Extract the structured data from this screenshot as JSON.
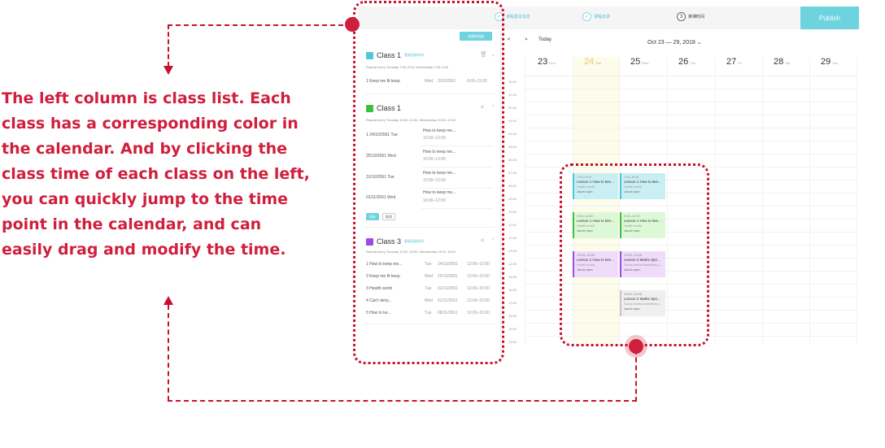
{
  "explanation": {
    "lines": [
      "The left column is class list. Each",
      "class has a corresponding color in",
      "the calendar. And by clicking the",
      "class time of each class on the left,",
      "you can quickly jump to the time",
      "point in the calendar, and can",
      "easily drag and modify the time."
    ]
  },
  "colors": {
    "annotation": "#d01f3c",
    "accent": "#6dd3df",
    "class1": "#4bc7d6",
    "class1b": "#3cc13b",
    "class3": "#9b4de3"
  },
  "steps": [
    {
      "num": "✓",
      "label": "课程基本信息"
    },
    {
      "num": "✓",
      "label": "课程目录"
    },
    {
      "num": "3",
      "label": "排课时间"
    }
  ],
  "publish_label": "Publish",
  "panel": {
    "create_label": "创建新班级",
    "classes": [
      {
        "name": "Class 1",
        "link": "更改班级时间",
        "repeat": "Repeat every Tuesday 7:00–9:00, Wednesday 7:00–9:00",
        "rows": [
          {
            "lesson": "1 Keep me fit keep",
            "day": "Wed",
            "date": "3/10/2561",
            "time": "9:00–11:00"
          }
        ]
      },
      {
        "name": "Class 1",
        "repeat": "Repeat every Tuesday 10:00–12:00, Wednesday 10:00–12:00",
        "rows": [
          {
            "date": "1  24/10/2561   Tue",
            "lesson": "How to keep me...",
            "time": "10:00–12:00"
          },
          {
            "date": "25/10/2561 Wed",
            "lesson": "How to keep me...",
            "time": "10:00–12:00"
          },
          {
            "date": "31/10/2561 Tue",
            "lesson": "How to keep me...",
            "time": "10:00–12:00"
          },
          {
            "date": "01/11/2561  Wed",
            "lesson": "How to keep me...",
            "time": "10:00–12:00"
          }
        ],
        "save_label": "保存",
        "cancel_label": "取消"
      },
      {
        "name": "Class 3",
        "link": "更改班级时间",
        "repeat": "Repeat every Tuesday 13:00–15:00, Wednesday 13:00–15:00",
        "rows": [
          {
            "lesson": "1 How to keep me...",
            "day": "Tue",
            "date": "24/10/2561",
            "time": "13:00–15:00"
          },
          {
            "lesson": "2 Keep me fit keep",
            "day": "Wed",
            "date": "25/10/2561",
            "time": "13:00–15:00"
          },
          {
            "lesson": "3 Health world",
            "day": "Tue",
            "date": "31/10/2561",
            "time": "13:00–15:00"
          },
          {
            "lesson": "4 Can't deny...",
            "day": "Wed",
            "date": "01/11/2561",
            "time": "13:00–15:00"
          },
          {
            "lesson": "5 How to ke...",
            "day": "Tue",
            "date": "08/11/2561",
            "time": "13:00–15:00"
          }
        ]
      }
    ]
  },
  "calendar": {
    "prev": "<",
    "next": ">",
    "today_label": "Today",
    "range": "Oct 23 — 29, 2018 ⌄",
    "days": [
      {
        "num": "23",
        "dow": "Mon"
      },
      {
        "num": "24",
        "dow": "Tue"
      },
      {
        "num": "25",
        "dow": "Wed"
      },
      {
        "num": "26",
        "dow": "Thu"
      },
      {
        "num": "27",
        "dow": "Fri"
      },
      {
        "num": "28",
        "dow": "Sat"
      },
      {
        "num": "29",
        "dow": "Sun"
      }
    ],
    "hours": [
      "00:00",
      "01:00",
      "02:00",
      "03:00",
      "04:00",
      "05:00",
      "06:00",
      "07:00",
      "08:00",
      "09:00",
      "10:00",
      "11:00",
      "12:00",
      "13:00",
      "14:00",
      "15:00",
      "16:00",
      "17:00",
      "18:00",
      "19:00",
      "20:00"
    ],
    "events": [
      {
        "time": "7:00–9:00",
        "name": "Lesson 1 How to kee...",
        "sub": "Health world",
        "person": "Jacob ryan"
      },
      {
        "time": "7:00–9:00",
        "name": "Lesson 1 How to kee...",
        "sub": "Health world",
        "person": "Jacob ryan"
      },
      {
        "time": "9:00–11:00",
        "name": "Lesson 1 How to kee...",
        "sub": "Health world",
        "person": "Jacob ryan"
      },
      {
        "time": "9:00–11:00",
        "name": "Lesson 1 How to kee...",
        "sub": "Health world",
        "person": "Jacob ryan"
      },
      {
        "time": "13:00–15:00",
        "name": "Lesson 1 How to kee...",
        "sub": "Health world",
        "person": "Jacob ryan"
      },
      {
        "time": "13:00–15:00",
        "name": "Lesson 2 Maths Spri...",
        "sub": "Socia media marketing c...",
        "person": "Jacob ryan"
      },
      {
        "time": "15:00–16:00",
        "name": "Lesson 2 Maths Spri...",
        "sub": "Socia media marketing c...",
        "person": "Jacob ryan"
      }
    ]
  }
}
